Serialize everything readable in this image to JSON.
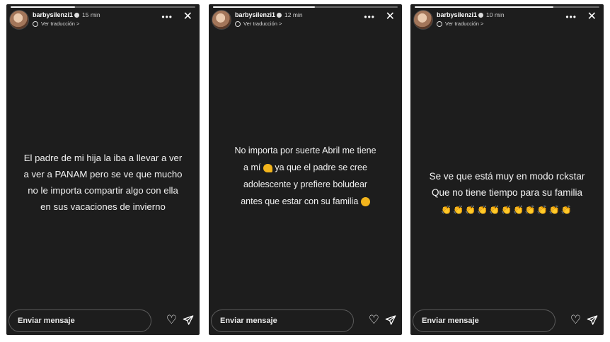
{
  "stories": [
    {
      "username": "barbysilenzi1",
      "time": "15 min",
      "translate": "Ver traducción >",
      "progress": 0.35,
      "message_lines": [
        "El padre de mi hija la iba a llevar a ver",
        "a ver a PANAM pero se ve que mucho",
        "no le importa compartir algo con ella",
        "en sus vacaciones de invierno"
      ],
      "send_placeholder": "Enviar mensaje"
    },
    {
      "username": "barbysilenzi1",
      "time": "12 min",
      "translate": "Ver traducción >",
      "progress": 0.55,
      "message_lines": [
        "No importa por suerte Abril me tiene",
        "a mí",
        "ya que el padre se cree",
        "adolescente y prefiere boludear",
        "antes que estar con su familia"
      ],
      "emojis": [
        "flexed-biceps-emoji",
        "smirk-emoji"
      ],
      "send_placeholder": "Enviar mensaje"
    },
    {
      "username": "barbysilenzi1",
      "time": "10 min",
      "translate": "Ver traducción >",
      "progress": 0.75,
      "message_lines": [
        "Se ve que  está muy en modo rckstar",
        "Que no tiene tiempo para su familia"
      ],
      "clap_count": 11,
      "send_placeholder": "Enviar mensaje"
    }
  ],
  "icons": {
    "more": "more-options-icon",
    "close": "close-icon",
    "heart": "heart-icon",
    "send": "send-icon",
    "clap": "clapping-hands-emoji"
  },
  "colors": {
    "story_bg": "#1d1d1d",
    "text": "#f2f2f2",
    "emoji": "#f2b41c"
  }
}
